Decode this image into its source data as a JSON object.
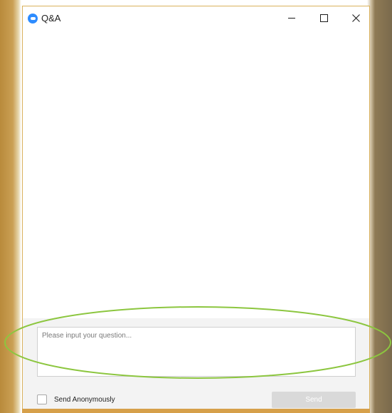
{
  "window": {
    "title": "Q&A",
    "app_icon": "zoom-logo-icon"
  },
  "title_controls": {
    "minimize_icon": "minimize-icon",
    "maximize_icon": "maximize-icon",
    "close_icon": "close-icon",
    "close_glyph": "✕"
  },
  "input": {
    "placeholder": "Please input your question...",
    "value": ""
  },
  "anonymous": {
    "label": "Send Anonymously",
    "checked": false
  },
  "send": {
    "label": "Send",
    "enabled": false
  },
  "colors": {
    "accent": "#2d8cff",
    "annotation": "#8cc63f",
    "window_border": "#d9b15c"
  }
}
